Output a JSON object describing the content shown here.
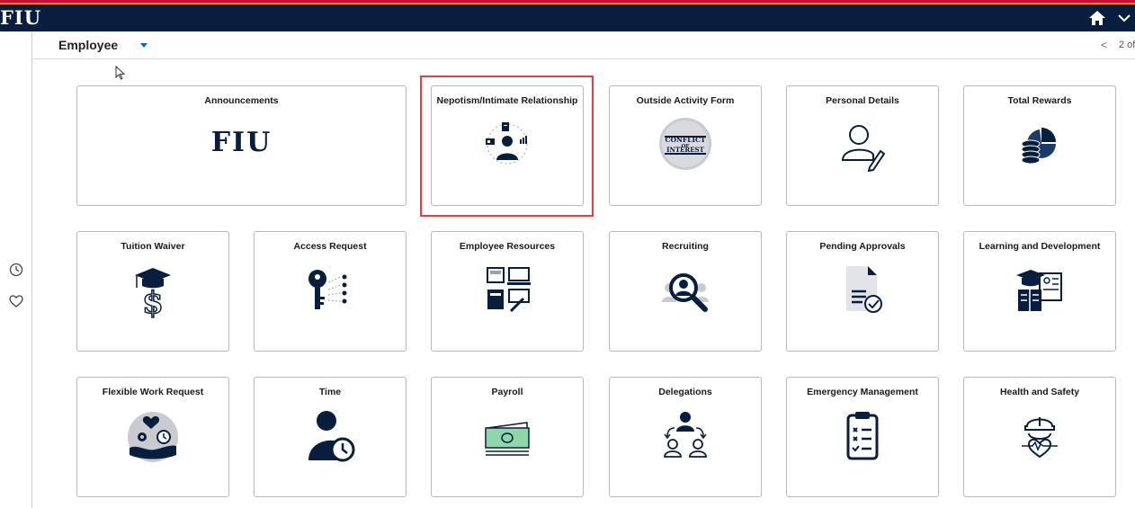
{
  "nav": {
    "logo": "FIU"
  },
  "header": {
    "title": "Employee",
    "pager": "2 of",
    "prev_glyph": "<"
  },
  "tiles": [
    {
      "title": "Announcements",
      "icon": "fiu-logo-icon",
      "logo_text": "FIU"
    },
    {
      "title": "Nepotism/Intimate Relationship",
      "icon": "relationship-network-icon"
    },
    {
      "title": "Outside Activity Form",
      "icon": "conflict-of-interest-stamp-icon",
      "stamp_lines": [
        "CONFLICT",
        "OF",
        "INTEREST"
      ]
    },
    {
      "title": "Personal Details",
      "icon": "person-edit-icon"
    },
    {
      "title": "Total Rewards",
      "icon": "coins-pie-chart-icon"
    },
    {
      "title": "Tuition Waiver",
      "icon": "graduation-dollar-icon"
    },
    {
      "title": "Access Request",
      "icon": "key-network-icon"
    },
    {
      "title": "Employee Resources",
      "icon": "resources-icon"
    },
    {
      "title": "Recruiting",
      "icon": "search-person-icon"
    },
    {
      "title": "Pending Approvals",
      "icon": "document-check-icon"
    },
    {
      "title": "Learning and Development",
      "icon": "graduation-book-icon"
    },
    {
      "title": "Flexible Work Request",
      "icon": "hand-heart-clock-icon"
    },
    {
      "title": "Time",
      "icon": "person-clock-icon"
    },
    {
      "title": "Payroll",
      "icon": "banknote-icon"
    },
    {
      "title": "Delegations",
      "icon": "delegation-people-icon"
    },
    {
      "title": "Emergency Management",
      "icon": "clipboard-checklist-icon"
    },
    {
      "title": "Health and Safety",
      "icon": "hardhat-heart-icon"
    }
  ],
  "sidebar": {
    "icons": [
      "recent-history-icon",
      "favorites-heart-icon"
    ]
  },
  "colors": {
    "navy": "#081e3f",
    "accent_red": "#c8102e",
    "gold": "#c9a227",
    "highlight": "#e0413d",
    "money_green": "#8fd6a8"
  }
}
